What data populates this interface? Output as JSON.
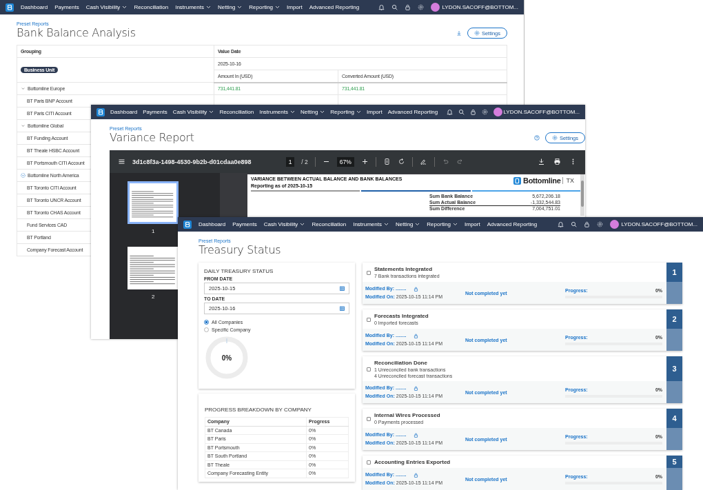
{
  "windows": [
    {
      "kind": "bank_balance",
      "nav": {
        "items": [
          {
            "label": "Dashboard",
            "dropdown": false
          },
          {
            "label": "Payments",
            "dropdown": false
          },
          {
            "label": "Cash Visibility",
            "dropdown": true
          },
          {
            "label": "Reconciliation",
            "dropdown": false
          },
          {
            "label": "Instruments",
            "dropdown": true
          },
          {
            "label": "Netting",
            "dropdown": true
          },
          {
            "label": "Reporting",
            "dropdown": true
          },
          {
            "label": "Import",
            "dropdown": false
          },
          {
            "label": "Advanced Reporting",
            "dropdown": false
          }
        ],
        "user": "LYDON.SACOFF@BOTTOM..."
      },
      "breadcrumb": "Preset Reports",
      "title": "Bank Balance Analysis",
      "settings": "Settings",
      "table": {
        "columns": [
          "Grouping",
          "Value Date"
        ],
        "badge": "Business Unit",
        "date": "2025-10-16",
        "amount_columns": [
          "Amount In (USD)",
          "Converted Amount (USD)"
        ],
        "groups": [
          {
            "label": "Bottomline Europe",
            "expanded": true,
            "loading": false,
            "amount_in": "731,441.81",
            "converted": "731,441.81",
            "children": [
              {
                "label": "BT Paris BNP Account"
              },
              {
                "label": "BT Paris CITI Account"
              }
            ]
          },
          {
            "label": "Bottomline Global",
            "expanded": true,
            "loading": false,
            "children": [
              {
                "label": "BT Funding Account"
              },
              {
                "label": "BT Theale HSBC Account"
              },
              {
                "label": "BT Portsmouth CITI Account"
              }
            ]
          },
          {
            "label": "Bottomline North America",
            "expanded": true,
            "loading": true,
            "children": [
              {
                "label": "BT Toronto CITI Account"
              },
              {
                "label": "BT Toronto UNCR Account"
              },
              {
                "label": "BT Toronto CHAS Account"
              },
              {
                "label": "Fund Services CAD"
              },
              {
                "label": "BT Portland"
              },
              {
                "label": "Company Forecast Account"
              }
            ]
          }
        ]
      }
    },
    {
      "kind": "variance",
      "nav": {
        "items": [
          {
            "label": "Dashboard",
            "dropdown": false
          },
          {
            "label": "Payments",
            "dropdown": false
          },
          {
            "label": "Cash Visibility",
            "dropdown": true
          },
          {
            "label": "Reconciliation",
            "dropdown": false
          },
          {
            "label": "Instruments",
            "dropdown": true
          },
          {
            "label": "Netting",
            "dropdown": true
          },
          {
            "label": "Reporting",
            "dropdown": true
          },
          {
            "label": "Import",
            "dropdown": false
          },
          {
            "label": "Advanced Reporting",
            "dropdown": false
          }
        ],
        "user": "LYDON.SACOFF@BOTTOM..."
      },
      "breadcrumb": "Preset Reports",
      "title": "Variance Report",
      "settings": "Settings",
      "viewer": {
        "file": "3d1c8f3a-1498-4530-9b2b-d01cdaa0e898",
        "page": "1",
        "page_count": "/ 2",
        "zoom": "67%",
        "thumbnails": [
          {
            "label": "1",
            "selected": true
          },
          {
            "label": "2",
            "selected": false
          }
        ],
        "document": {
          "heading": "VARIANCE BETWEEN ACTUAL BALANCE AND BANK BALANCES",
          "subheading": "Reporting as of 2025-10-15",
          "brand": "Bottomline",
          "brand_suffix": "TX",
          "sums": [
            {
              "label": "Sum Bank Balance",
              "value": "5,672,206.18"
            },
            {
              "label": "Sum Actual Balance",
              "value": "-1,332,544.83"
            },
            {
              "label": "Sum Difference",
              "value": "7,004,751.01"
            }
          ]
        }
      }
    },
    {
      "kind": "treasury",
      "nav": {
        "items": [
          {
            "label": "Dashboard",
            "dropdown": false
          },
          {
            "label": "Payments",
            "dropdown": false
          },
          {
            "label": "Cash Visibility",
            "dropdown": true
          },
          {
            "label": "Reconciliation",
            "dropdown": false
          },
          {
            "label": "Instruments",
            "dropdown": true
          },
          {
            "label": "Netting",
            "dropdown": true
          },
          {
            "label": "Reporting",
            "dropdown": true
          },
          {
            "label": "Import",
            "dropdown": false
          },
          {
            "label": "Advanced Reporting",
            "dropdown": false
          }
        ],
        "user": "LYDON.SACOFF@BOTTOM..."
      },
      "breadcrumb": "Preset Reports",
      "title": "Treasury Status",
      "daily": {
        "title": "DAILY TREASURY STATUS",
        "fields": [
          {
            "label": "FROM DATE",
            "value": "2025-10-15"
          },
          {
            "label": "TO DATE",
            "value": "2025-10-16"
          }
        ],
        "options": [
          {
            "label": "All Companies",
            "selected": true
          },
          {
            "label": "Specific Company",
            "selected": false
          }
        ],
        "progress": {
          "label": "0%"
        }
      },
      "breakdown": {
        "title": "PROGRESS BREAKDOWN BY COMPANY",
        "columns": [
          "Company",
          "Progress"
        ],
        "rows": [
          [
            "BT Canada",
            "0%"
          ],
          [
            "BT Paris",
            "0%"
          ],
          [
            "BT Portsmouth",
            "0%"
          ],
          [
            "BT South Portland",
            "0%"
          ],
          [
            "BT Theale",
            "0%"
          ],
          [
            "Company Forecasting Entity",
            "0%"
          ]
        ]
      },
      "steps": [
        {
          "number": "1",
          "title": "Statements Integrated",
          "details": [
            "7 Bank transactions integrated"
          ],
          "checked": false,
          "modified_by_label": "Modified By:",
          "modified_by": "........",
          "modified_on_label": "Modified On:",
          "modified_on": "2025-10-15 11:14 PM",
          "status": "Not completed yet",
          "progress_label": "Progress:",
          "progress": "0%",
          "level": 0
        },
        {
          "number": "2",
          "title": "Forecasts Integrated",
          "details": [
            "0 Imported forecasts"
          ],
          "checked": false,
          "modified_by_label": "Modified By:",
          "modified_by": "........",
          "modified_on_label": "Modified On:",
          "modified_on": "2025-10-15 11:14 PM",
          "status": "Not completed yet",
          "progress_label": "Progress:",
          "progress": "0%",
          "level": 0
        },
        {
          "number": "3",
          "title": "Reconciliation Done",
          "details": [
            "1 Unreconciled bank transactions",
            "4 Unreconciled forecast transactions"
          ],
          "checked": false,
          "modified_by_label": "Modified By:",
          "modified_by": "........",
          "modified_on_label": "Modified On:",
          "modified_on": "2025-10-15 11:14 PM",
          "status": "Not completed yet",
          "progress_label": "Progress:",
          "progress": "0%",
          "level": 0
        },
        {
          "number": "4",
          "title": "Internal Wires Processed",
          "details": [
            "0 Payments processed"
          ],
          "checked": false,
          "modified_by_label": "Modified By:",
          "modified_by": "........",
          "modified_on_label": "Modified On:",
          "modified_on": "2025-10-15 11:14 PM",
          "status": "Not completed yet",
          "progress_label": "Progress:",
          "progress": "0%",
          "level": 0
        },
        {
          "number": "5",
          "title": "Accounting Entries Exported",
          "checked": false,
          "modified_by_label": "Modified By:",
          "modified_by": "........",
          "modified_on_label": "Modified On:",
          "modified_on": "2025-10-15 11:14 PM",
          "status": "Not completed yet",
          "progress_label": "Progress:",
          "progress": "0%",
          "level": 0
        }
      ]
    }
  ]
}
